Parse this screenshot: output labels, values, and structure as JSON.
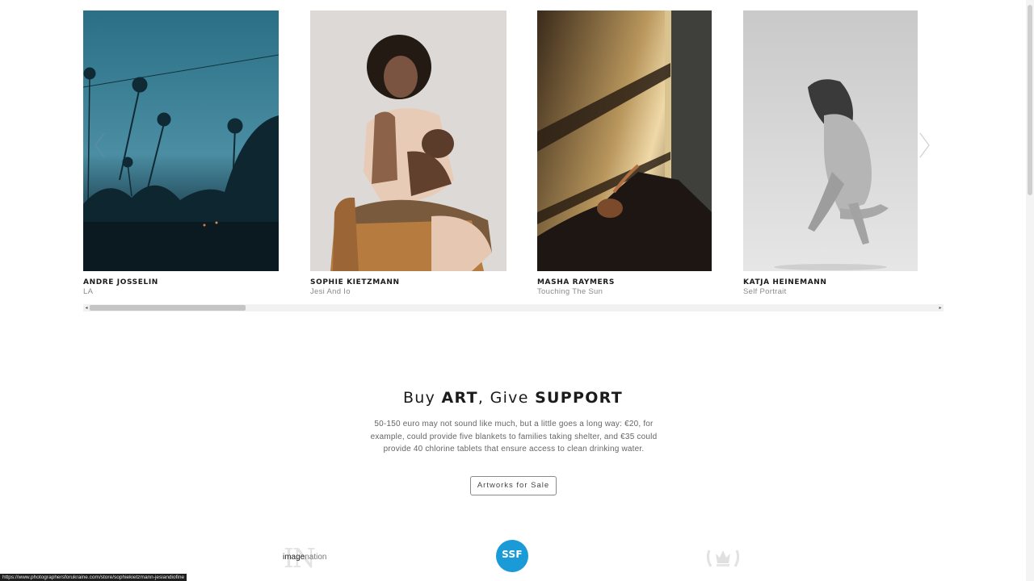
{
  "gallery": {
    "items": [
      {
        "artist": "ANDRE JOSSELIN",
        "work": "LA"
      },
      {
        "artist": "SOPHIE KIETZMANN",
        "work": "Jesi And Io"
      },
      {
        "artist": "MASHA RAYMERS",
        "work": "Touching The Sun"
      },
      {
        "artist": "KATJA HEINEMANN",
        "work": "Self Portrait"
      }
    ],
    "scroll_progress": 0.18
  },
  "support": {
    "title_parts": [
      "Buy",
      "ART",
      ", Give",
      "SUPPORT"
    ],
    "text": "50-150 euro may not sound like much, but a little goes a long way: €20, for example, could provide five blankets to families taking shelter, and €35 could provide 40 chlorine tablets that ensure access to clean drinking water.",
    "button_label": "Artworks for Sale"
  },
  "partners": {
    "imagenation_bold": "image",
    "imagenation_light": "nation",
    "imagenation_mark": "IN",
    "ssf_label": "SSF"
  },
  "status_url": "https://www.photographersforukraine.com/store/sophiekietzmann-jesiandiofine",
  "icons": {
    "prev": "chevron-left-icon",
    "next": "chevron-right-icon"
  }
}
